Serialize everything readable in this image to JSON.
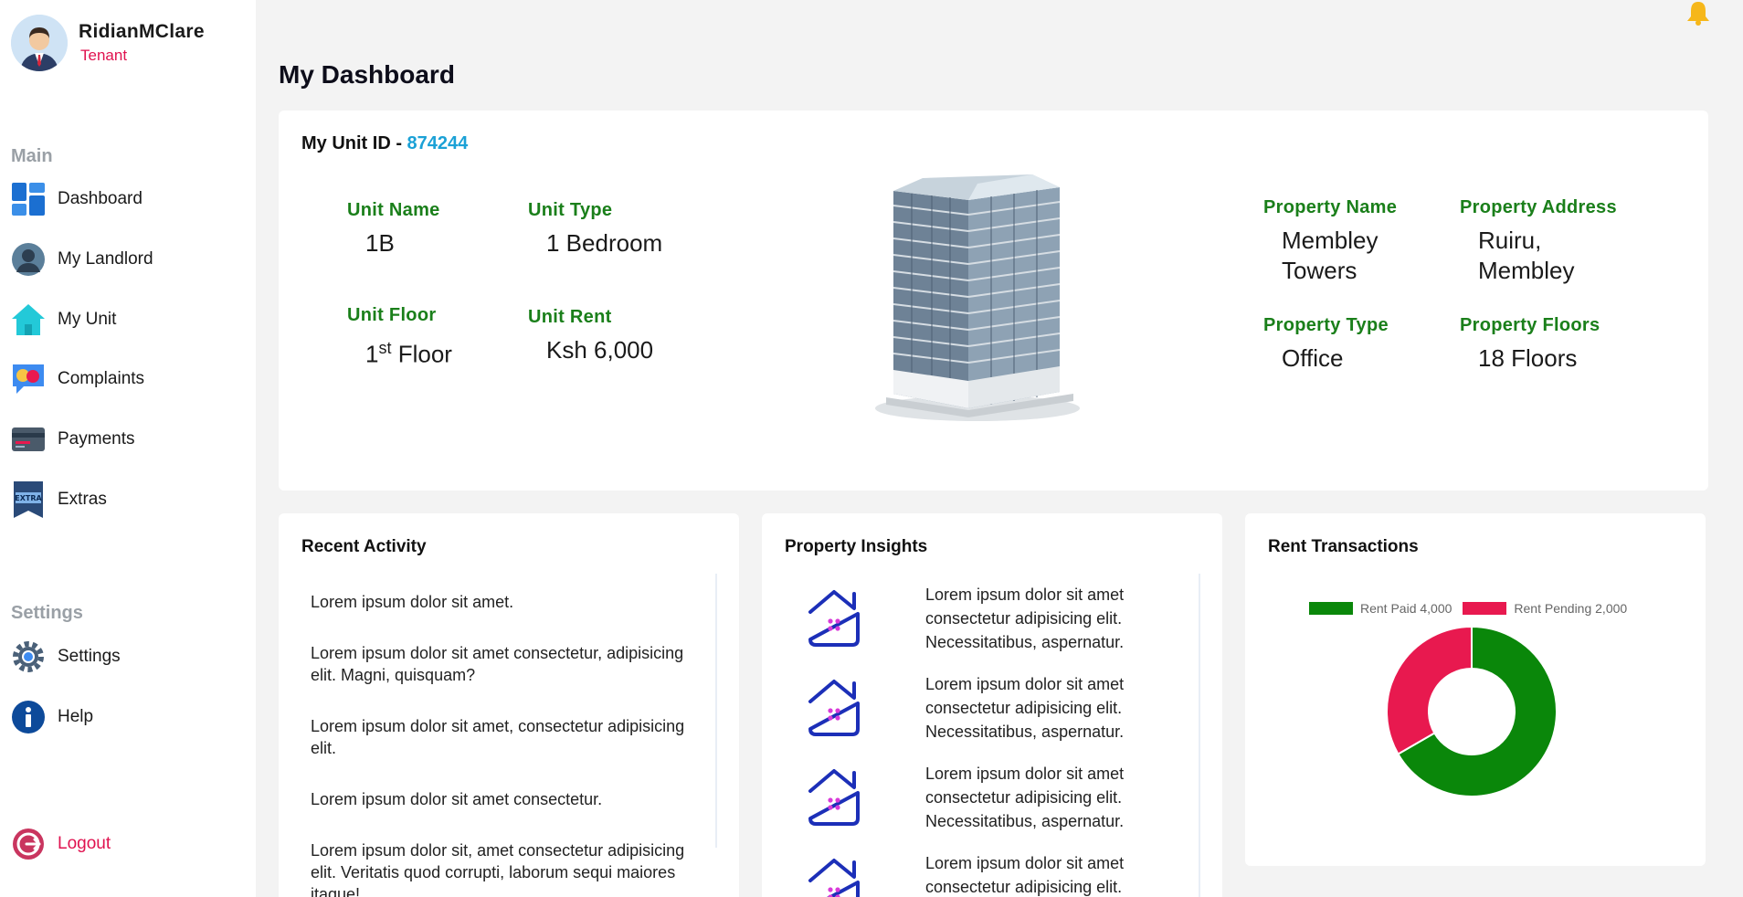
{
  "profile": {
    "name": "RidianMClare",
    "role": "Tenant"
  },
  "sidebar": {
    "main_label": "Main",
    "settings_label": "Settings",
    "items": [
      {
        "label": "Dashboard",
        "icon": "dashboard-icon"
      },
      {
        "label": "My Landlord",
        "icon": "landlord-icon"
      },
      {
        "label": "My Unit",
        "icon": "home-icon"
      },
      {
        "label": "Complaints",
        "icon": "complaints-icon"
      },
      {
        "label": "Payments",
        "icon": "credit-card-icon"
      },
      {
        "label": "Extras",
        "icon": "extras-icon"
      }
    ],
    "settings_items": [
      {
        "label": "Settings",
        "icon": "gear-icon"
      },
      {
        "label": "Help",
        "icon": "info-icon"
      }
    ],
    "logout_label": "Logout"
  },
  "page": {
    "title": "My Dashboard"
  },
  "unit": {
    "id_label": "My Unit ID - ",
    "id_value": "874244",
    "name_label": "Unit Name",
    "name_value": "1B",
    "type_label": "Unit Type",
    "type_value": "1 Bedroom",
    "floor_label": "Unit Floor",
    "floor_value_num": "1",
    "floor_value_sup": "st",
    "floor_value_suffix": " Floor",
    "rent_label": "Unit Rent",
    "rent_value": "Ksh 6,000"
  },
  "property": {
    "name_label": "Property Name",
    "name_value": "Membley Towers",
    "address_label": "Property Address",
    "address_value": "Ruiru, Membley",
    "type_label": "Property Type",
    "type_value": "Office",
    "floors_label": "Property Floors",
    "floors_value": "18 Floors"
  },
  "activity": {
    "title": "Recent Activity",
    "items": [
      "Lorem ipsum dolor sit amet.",
      "Lorem ipsum dolor sit amet consectetur, adipisicing elit. Magni, quisquam?",
      "Lorem ipsum dolor sit amet, consectetur adipisicing elit.",
      "Lorem ipsum dolor sit amet consectetur.",
      "Lorem ipsum dolor sit, amet consectetur adipisicing elit. Veritatis quod corrupti, laborum sequi maiores itaque!"
    ]
  },
  "insights": {
    "title": "Property Insights",
    "items": [
      "Lorem ipsum dolor sit amet consectetur adipisicing elit. Necessitatibus, aspernatur.",
      "Lorem ipsum dolor sit amet consectetur adipisicing elit. Necessitatibus, aspernatur.",
      "Lorem ipsum dolor sit amet consectetur adipisicing elit. Necessitatibus, aspernatur.",
      "Lorem ipsum dolor sit amet consectetur adipisicing elit. Necessitatibus, aspernatur."
    ]
  },
  "rent": {
    "title": "Rent Transactions"
  },
  "chart_data": {
    "type": "pie",
    "categories": [
      "Rent Paid 4,000",
      "Rent Pending 2,000"
    ],
    "values": [
      4000,
      2000
    ],
    "colors": [
      "#0a870a",
      "#e8194f"
    ],
    "legend": "top",
    "donut": true
  },
  "colors": {
    "accent": "#1ba1d6",
    "green": "#1a7f1a",
    "red": "#e0124f"
  }
}
